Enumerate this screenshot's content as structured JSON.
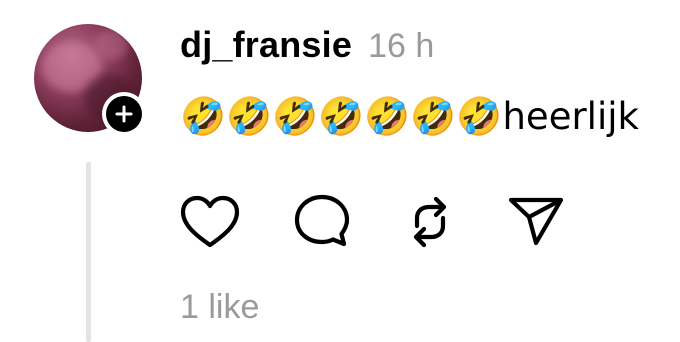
{
  "post": {
    "author": {
      "username": "dj_fransie",
      "avatar_icon": "profile-photo",
      "follow_icon": "plus-icon"
    },
    "timestamp": "16 h",
    "text": "🤣🤣🤣🤣🤣🤣🤣heerlijk",
    "actions": [
      {
        "icon": "heart-icon",
        "label": "Like"
      },
      {
        "icon": "comment-icon",
        "label": "Reply"
      },
      {
        "icon": "repost-icon",
        "label": "Repost"
      },
      {
        "icon": "share-icon",
        "label": "Share"
      }
    ],
    "likes": "1 like"
  },
  "colors": {
    "text": "#000000",
    "muted": "#9a9a9a",
    "thread_line": "#e4e4e4"
  }
}
